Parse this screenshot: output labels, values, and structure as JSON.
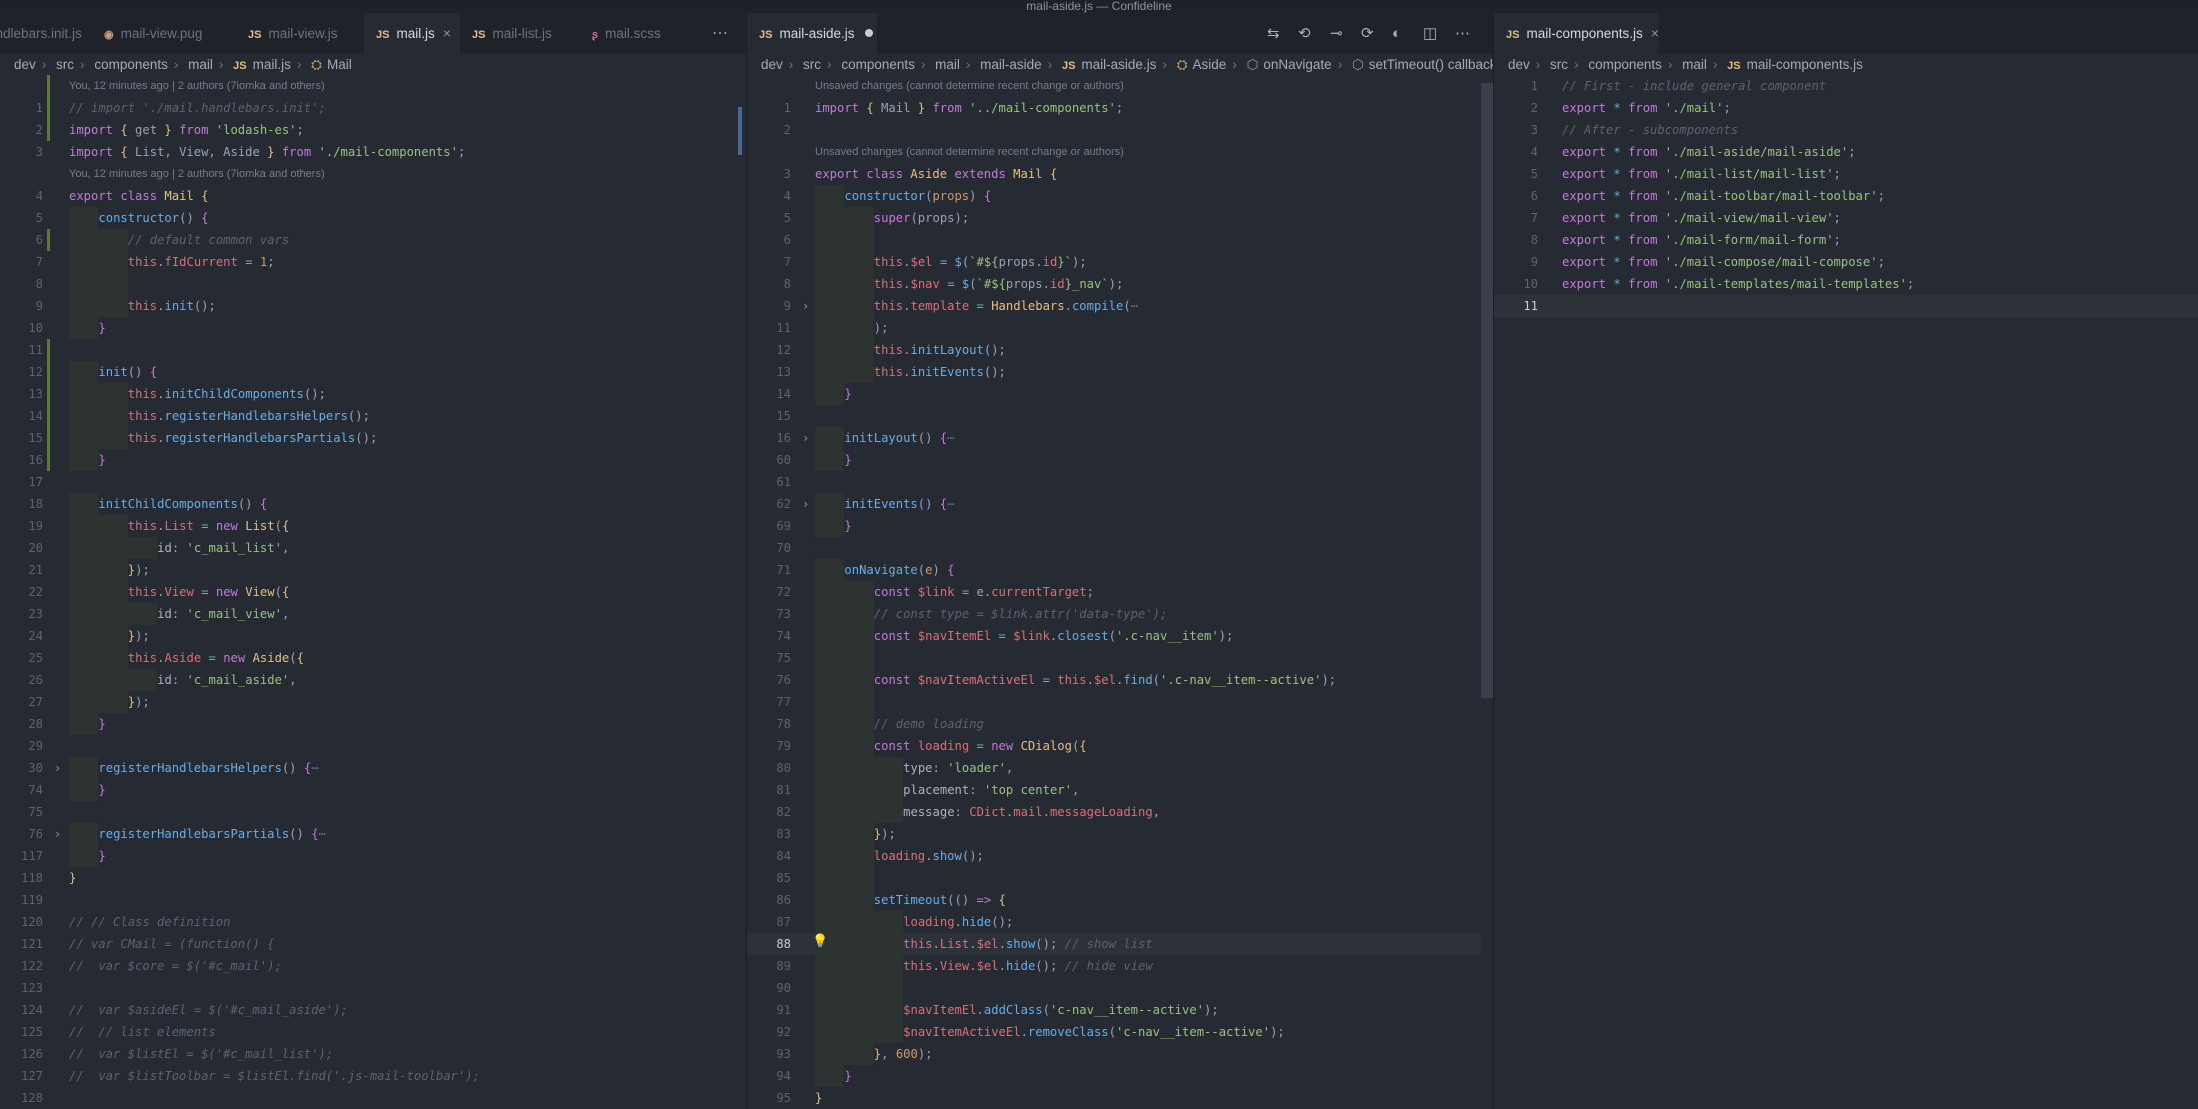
{
  "window": {
    "title": "mail-aside.js — Confideline"
  },
  "colors": {
    "background": "#262a33",
    "tabbar": "#1f2228",
    "keyword": "#c678dd",
    "string": "#98c379",
    "function": "#61afef",
    "class": "#e5c07b",
    "this": "#e06c75",
    "comment": "#5c6370"
  },
  "left": {
    "tabs": [
      {
        "label": "handlebars.init.js",
        "icon": "js-file-icon"
      },
      {
        "label": "mail-view.pug",
        "icon": "pug-file-icon"
      },
      {
        "label": "mail-view.js",
        "icon": "js-file-icon"
      },
      {
        "label": "mail.js",
        "icon": "js-file-icon",
        "active": true
      },
      {
        "label": "mail-list.js",
        "icon": "js-file-icon"
      },
      {
        "label": "mail.scss",
        "icon": "sass-file-icon"
      }
    ],
    "breadcrumbs": [
      "dev",
      "src",
      "components",
      "mail",
      "mail.js",
      "Mail"
    ],
    "codelens": [
      {
        "before": 1,
        "text": "You, 12 minutes ago | 2 authors (7iomka and others)"
      },
      {
        "before": 4,
        "text": "You, 12 minutes ago | 2 authors (7iomka and others)"
      }
    ],
    "lines": [
      {
        "n": "1",
        "i": 0,
        "h": "<span class=\"cm\">// import './mail.handlebars.init';</span>"
      },
      {
        "n": "2",
        "i": 0,
        "h": "<span class=\"kw\">import</span> <span class=\"br\">{</span> get <span class=\"br\">}</span> <span class=\"kw\">from</span> <span class=\"str\">'lodash-es'</span>;"
      },
      {
        "n": "3",
        "i": 0,
        "h": "<span class=\"kw\">import</span> <span class=\"br\">{</span> List, View, Aside <span class=\"br\">}</span> <span class=\"kw\">from</span> <span class=\"str\">'./mail-components'</span>;"
      },
      {
        "n": "4",
        "i": 0,
        "h": "<span class=\"kw\">export class</span> <span class=\"cl\">Mail</span> <span class=\"br\">{</span>"
      },
      {
        "n": "5",
        "i": 1,
        "h": "<span class=\"fn\">constructor</span>() <span class=\"kw\">{</span>"
      },
      {
        "n": "6",
        "i": 2,
        "h": "<span class=\"cm\">// default common vars</span>"
      },
      {
        "n": "7",
        "i": 2,
        "h": "<span class=\"th\">this</span>.<span class=\"var\">fIdCurrent</span> <span class=\"op\">=</span> <span class=\"num\">1</span>;"
      },
      {
        "n": "8",
        "i": 2,
        "h": ""
      },
      {
        "n": "9",
        "i": 2,
        "h": "<span class=\"th\">this</span>.<span class=\"fn\">init</span>();"
      },
      {
        "n": "10",
        "i": 1,
        "h": "<span class=\"kw\">}</span>"
      },
      {
        "n": "11",
        "i": 0,
        "h": ""
      },
      {
        "n": "12",
        "i": 1,
        "h": "<span class=\"fn\">init</span>() <span class=\"kw\">{</span>"
      },
      {
        "n": "13",
        "i": 2,
        "h": "<span class=\"th\">this</span>.<span class=\"fn\">initChildComponents</span>();"
      },
      {
        "n": "14",
        "i": 2,
        "h": "<span class=\"th\">this</span>.<span class=\"fn\">registerHandlebarsHelpers</span>();"
      },
      {
        "n": "15",
        "i": 2,
        "h": "<span class=\"th\">this</span>.<span class=\"fn\">registerHandlebarsPartials</span>();"
      },
      {
        "n": "16",
        "i": 1,
        "h": "<span class=\"kw\">}</span>"
      },
      {
        "n": "17",
        "i": 0,
        "h": ""
      },
      {
        "n": "18",
        "i": 1,
        "h": "<span class=\"fn\">initChildComponents</span>() <span class=\"kw\">{</span>"
      },
      {
        "n": "19",
        "i": 2,
        "h": "<span class=\"th\">this</span>.<span class=\"var\">List</span> <span class=\"op\">=</span> <span class=\"kw\">new</span> <span class=\"cl\">List</span>(<span class=\"br\">{</span>"
      },
      {
        "n": "20",
        "i": 3,
        "h": "<span class=\"pl\">id</span>: <span class=\"str\">'c_mail_list'</span>,"
      },
      {
        "n": "21",
        "i": 2,
        "h": "<span class=\"br\">}</span>);"
      },
      {
        "n": "22",
        "i": 2,
        "h": "<span class=\"th\">this</span>.<span class=\"var\">View</span> <span class=\"op\">=</span> <span class=\"kw\">new</span> <span class=\"cl\">View</span>(<span class=\"br\">{</span>"
      },
      {
        "n": "23",
        "i": 3,
        "h": "<span class=\"pl\">id</span>: <span class=\"str\">'c_mail_view'</span>,"
      },
      {
        "n": "24",
        "i": 2,
        "h": "<span class=\"br\">}</span>);"
      },
      {
        "n": "25",
        "i": 2,
        "h": "<span class=\"th\">this</span>.<span class=\"var\">Aside</span> <span class=\"op\">=</span> <span class=\"kw\">new</span> <span class=\"cl\">Aside</span>(<span class=\"br\">{</span>"
      },
      {
        "n": "26",
        "i": 3,
        "h": "<span class=\"pl\">id</span>: <span class=\"str\">'c_mail_aside'</span>,"
      },
      {
        "n": "27",
        "i": 2,
        "h": "<span class=\"br\">}</span>);"
      },
      {
        "n": "28",
        "i": 1,
        "h": "<span class=\"kw\">}</span>"
      },
      {
        "n": "29",
        "i": 0,
        "h": ""
      },
      {
        "n": "30",
        "i": 1,
        "fold": true,
        "h": "<span class=\"fn\">registerHandlebarsHelpers</span>() <span class=\"kw\">{</span><span class=\"fo\">⋯</span>"
      },
      {
        "n": "74",
        "i": 1,
        "h": "<span class=\"kw\">}</span>"
      },
      {
        "n": "75",
        "i": 0,
        "h": ""
      },
      {
        "n": "76",
        "i": 1,
        "fold": true,
        "h": "<span class=\"fn\">registerHandlebarsPartials</span>() <span class=\"kw\">{</span><span class=\"fo\">⋯</span>"
      },
      {
        "n": "117",
        "i": 1,
        "h": "<span class=\"kw\">}</span>"
      },
      {
        "n": "118",
        "i": 0,
        "h": "<span class=\"br\">}</span>"
      },
      {
        "n": "119",
        "i": 0,
        "h": ""
      },
      {
        "n": "120",
        "i": 0,
        "h": "<span class=\"cm\">// // Class definition</span>"
      },
      {
        "n": "121",
        "i": 0,
        "h": "<span class=\"cm\">// var CMail = (function() {</span>"
      },
      {
        "n": "122",
        "i": 0,
        "h": "<span class=\"cm\">//  var $core = $('#c_mail');</span>"
      },
      {
        "n": "123",
        "i": 0,
        "h": ""
      },
      {
        "n": "124",
        "i": 0,
        "h": "<span class=\"cm\">//  var $asideEl = $('#c_mail_aside');</span>"
      },
      {
        "n": "125",
        "i": 0,
        "h": "<span class=\"cm\">//  // list elements</span>"
      },
      {
        "n": "126",
        "i": 0,
        "h": "<span class=\"cm\">//  var $listEl = $('#c_mail_list');</span>"
      },
      {
        "n": "127",
        "i": 0,
        "h": "<span class=\"cm\">//  var $listToolbar = $listEl.find('.js-mail-toolbar');</span>"
      },
      {
        "n": "128",
        "i": 0,
        "h": ""
      }
    ]
  },
  "middle": {
    "tabs": [
      {
        "label": "mail-aside.js",
        "icon": "js-file-icon",
        "active": true,
        "dirty": true
      }
    ],
    "breadcrumbs": [
      "dev",
      "src",
      "components",
      "mail",
      "mail-aside",
      "mail-aside.js",
      "Aside",
      "onNavigate",
      "setTimeout() callback"
    ],
    "codelens": [
      {
        "before": 1,
        "text": "Unsaved changes (cannot determine recent change or authors)"
      },
      {
        "before": 3,
        "text": "Unsaved changes (cannot determine recent change or authors)"
      }
    ],
    "lines": [
      {
        "n": "1",
        "i": 0,
        "h": "<span class=\"kw\">import</span> <span class=\"br\">{</span> Mail <span class=\"br\">}</span> <span class=\"kw\">from</span> <span class=\"str\">'../mail-components'</span>;"
      },
      {
        "n": "2",
        "i": 0,
        "h": ""
      },
      {
        "n": "3",
        "i": 0,
        "h": "<span class=\"kw\">export class</span> <span class=\"cl\">Aside</span> <span class=\"kw\">extends</span> <span class=\"cl\">Mail</span> <span class=\"br\">{</span>"
      },
      {
        "n": "4",
        "i": 1,
        "h": "<span class=\"fn\">constructor</span>(<span class=\"pr\">props</span>) <span class=\"kw\">{</span>"
      },
      {
        "n": "5",
        "i": 2,
        "h": "<span class=\"kw\">super</span>(props);"
      },
      {
        "n": "6",
        "i": 2,
        "h": ""
      },
      {
        "n": "7",
        "i": 2,
        "h": "<span class=\"th\">this</span>.<span class=\"var\">$el</span> <span class=\"op\">=</span> <span class=\"fn\">$</span>(<span class=\"str\">`#${</span>props.<span class=\"var\">id</span><span class=\"str\">}`</span>);"
      },
      {
        "n": "8",
        "i": 2,
        "h": "<span class=\"th\">this</span>.<span class=\"var\">$nav</span> <span class=\"op\">=</span> <span class=\"fn\">$</span>(<span class=\"str\">`#${</span>props.<span class=\"var\">id</span><span class=\"str\">}_nav`</span>);"
      },
      {
        "n": "9",
        "i": 2,
        "fold": true,
        "h": "<span class=\"th\">this</span>.<span class=\"var\">template</span> <span class=\"op\">=</span> <span class=\"cl\">Handlebars</span>.<span class=\"fn\">compile</span>(<span class=\"fo\">⋯</span>"
      },
      {
        "n": "11",
        "i": 2,
        "h": ");"
      },
      {
        "n": "12",
        "i": 2,
        "h": "<span class=\"th\">this</span>.<span class=\"fn\">initLayout</span>();"
      },
      {
        "n": "13",
        "i": 2,
        "h": "<span class=\"th\">this</span>.<span class=\"fn\">initEvents</span>();"
      },
      {
        "n": "14",
        "i": 1,
        "h": "<span class=\"kw\">}</span>"
      },
      {
        "n": "15",
        "i": 0,
        "h": ""
      },
      {
        "n": "16",
        "i": 1,
        "fold": true,
        "h": "<span class=\"fn\">initLayout</span>() <span class=\"kw\">{</span><span class=\"fo\">⋯</span>"
      },
      {
        "n": "60",
        "i": 1,
        "h": "<span class=\"kw\">}</span>"
      },
      {
        "n": "61",
        "i": 0,
        "h": ""
      },
      {
        "n": "62",
        "i": 1,
        "fold": true,
        "h": "<span class=\"fn\">initEvents</span>() <span class=\"kw\">{</span><span class=\"fo\">⋯</span>"
      },
      {
        "n": "69",
        "i": 1,
        "h": "<span class=\"kw\">}</span>"
      },
      {
        "n": "70",
        "i": 0,
        "h": ""
      },
      {
        "n": "71",
        "i": 1,
        "h": "<span class=\"fn\">onNavigate</span>(<span class=\"pr\">e</span>) <span class=\"kw\">{</span>"
      },
      {
        "n": "72",
        "i": 2,
        "h": "<span class=\"kw\">const</span> <span class=\"var\">$link</span> <span class=\"op\">=</span> e.<span class=\"var\">currentTarget</span>;"
      },
      {
        "n": "73",
        "i": 2,
        "h": "<span class=\"cm\">// const type = $link.attr('data-type');</span>"
      },
      {
        "n": "74",
        "i": 2,
        "h": "<span class=\"kw\">const</span> <span class=\"var\">$navItemEl</span> <span class=\"op\">=</span> <span class=\"var\">$link</span>.<span class=\"fn\">closest</span>(<span class=\"str\">'.c-nav__item'</span>);"
      },
      {
        "n": "75",
        "i": 2,
        "h": ""
      },
      {
        "n": "76",
        "i": 2,
        "h": "<span class=\"kw\">const</span> <span class=\"var\">$navItemActiveEl</span> <span class=\"op\">=</span> <span class=\"th\">this</span>.<span class=\"var\">$el</span>.<span class=\"fn\">find</span>(<span class=\"str\">'.c-nav__item--active'</span>);"
      },
      {
        "n": "77",
        "i": 2,
        "h": ""
      },
      {
        "n": "78",
        "i": 2,
        "h": "<span class=\"cm\">// demo loading</span>"
      },
      {
        "n": "79",
        "i": 2,
        "h": "<span class=\"kw\">const</span> <span class=\"var\">loading</span> <span class=\"op\">=</span> <span class=\"kw\">new</span> <span class=\"cl\">CDialog</span>(<span class=\"br\">{</span>"
      },
      {
        "n": "80",
        "i": 3,
        "h": "<span class=\"pl\">type</span>: <span class=\"str\">'loader'</span>,"
      },
      {
        "n": "81",
        "i": 3,
        "h": "<span class=\"pl\">placement</span>: <span class=\"str\">'top center'</span>,"
      },
      {
        "n": "82",
        "i": 3,
        "h": "<span class=\"pl\">message</span>: <span class=\"var\">CDict</span>.<span class=\"var\">mail</span>.<span class=\"var\">messageLoading</span>,"
      },
      {
        "n": "83",
        "i": 2,
        "h": "<span class=\"br\">}</span>);"
      },
      {
        "n": "84",
        "i": 2,
        "h": "<span class=\"var\">loading</span>.<span class=\"fn\">show</span>();"
      },
      {
        "n": "85",
        "i": 2,
        "h": ""
      },
      {
        "n": "86",
        "i": 2,
        "h": "<span class=\"fn\">setTimeout</span>(() <span class=\"kw\">=&gt;</span> <span class=\"br\">{</span>"
      },
      {
        "n": "87",
        "i": 3,
        "h": "<span class=\"var\">loading</span>.<span class=\"fn\">hide</span>();"
      },
      {
        "n": "88",
        "i": 3,
        "cur": true,
        "h": "<span class=\"th\">this</span>.<span class=\"var\">List</span>.<span class=\"var\">$el</span>.<span class=\"fn\">show</span>(); <span class=\"cm\">// show list</span>"
      },
      {
        "n": "89",
        "i": 3,
        "h": "<span class=\"th\">this</span>.<span class=\"var\">View</span>.<span class=\"var\">$el</span>.<span class=\"fn\">hide</span>(); <span class=\"cm\">// hide view</span>"
      },
      {
        "n": "90",
        "i": 3,
        "h": ""
      },
      {
        "n": "91",
        "i": 3,
        "h": "<span class=\"var\">$navItemEl</span>.<span class=\"fn\">addClass</span>(<span class=\"str\">'c-nav__item--active'</span>);"
      },
      {
        "n": "92",
        "i": 3,
        "h": "<span class=\"var\">$navItemActiveEl</span>.<span class=\"fn\">removeClass</span>(<span class=\"str\">'c-nav__item--active'</span>);"
      },
      {
        "n": "93",
        "i": 2,
        "h": "<span class=\"br\">}</span>, <span class=\"num\">600</span>);"
      },
      {
        "n": "94",
        "i": 1,
        "h": "<span class=\"kw\">}</span>"
      },
      {
        "n": "95",
        "i": 0,
        "h": "<span class=\"br\">}</span>"
      }
    ]
  },
  "right": {
    "tabs": [
      {
        "label": "mail-components.js",
        "icon": "js-file-icon",
        "active": true
      }
    ],
    "breadcrumbs": [
      "dev",
      "src",
      "components",
      "mail",
      "mail-components.js"
    ],
    "codelens": [],
    "lines": [
      {
        "n": "1",
        "i": 0,
        "h": "<span class=\"cm\">// First - include general component</span>"
      },
      {
        "n": "2",
        "i": 0,
        "h": "<span class=\"kw\">export</span> <span class=\"op\">*</span> <span class=\"kw\">from</span> <span class=\"str\">'./mail'</span>;"
      },
      {
        "n": "3",
        "i": 0,
        "h": "<span class=\"cm\">// After - subcomponents</span>"
      },
      {
        "n": "4",
        "i": 0,
        "h": "<span class=\"kw\">export</span> <span class=\"op\">*</span> <span class=\"kw\">from</span> <span class=\"str\">'./mail-aside/mail-aside'</span>;"
      },
      {
        "n": "5",
        "i": 0,
        "h": "<span class=\"kw\">export</span> <span class=\"op\">*</span> <span class=\"kw\">from</span> <span class=\"str\">'./mail-list/mail-list'</span>;"
      },
      {
        "n": "6",
        "i": 0,
        "h": "<span class=\"kw\">export</span> <span class=\"op\">*</span> <span class=\"kw\">from</span> <span class=\"str\">'./mail-toolbar/mail-toolbar'</span>;"
      },
      {
        "n": "7",
        "i": 0,
        "h": "<span class=\"kw\">export</span> <span class=\"op\">*</span> <span class=\"kw\">from</span> <span class=\"str\">'./mail-view/mail-view'</span>;"
      },
      {
        "n": "8",
        "i": 0,
        "h": "<span class=\"kw\">export</span> <span class=\"op\">*</span> <span class=\"kw\">from</span> <span class=\"str\">'./mail-form/mail-form'</span>;"
      },
      {
        "n": "9",
        "i": 0,
        "h": "<span class=\"kw\">export</span> <span class=\"op\">*</span> <span class=\"kw\">from</span> <span class=\"str\">'./mail-compose/mail-compose'</span>;"
      },
      {
        "n": "10",
        "i": 0,
        "h": "<span class=\"kw\">export</span> <span class=\"op\">*</span> <span class=\"kw\">from</span> <span class=\"str\">'./mail-templates/mail-templates'</span>;"
      },
      {
        "n": "11",
        "i": 0,
        "cur": true,
        "h": ""
      }
    ]
  }
}
